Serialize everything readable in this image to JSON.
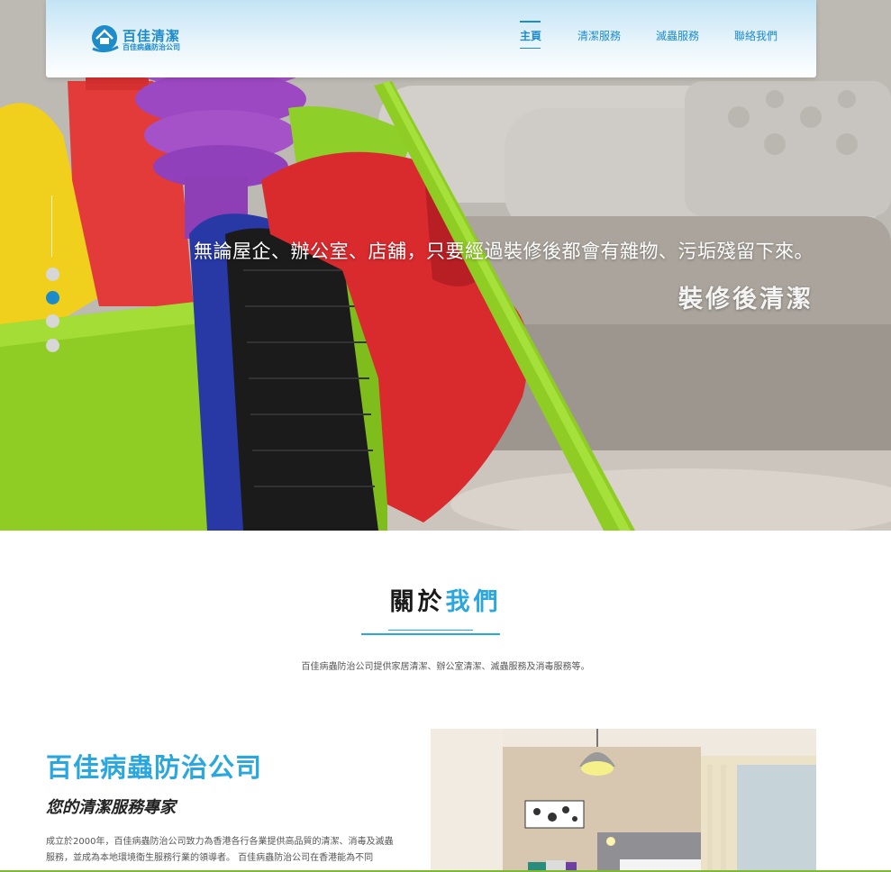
{
  "nav": {
    "logo_title": "百佳清潔",
    "logo_subtitle": "百佳病蟲防治公司",
    "items": [
      {
        "label": "主頁",
        "active": true
      },
      {
        "label": "清潔服務",
        "active": false
      },
      {
        "label": "滅蟲服務",
        "active": false
      },
      {
        "label": "聯絡我們",
        "active": false
      }
    ]
  },
  "hero": {
    "line1": "無論屋企、辦公室、店舖，只要經過裝修後都會有雜物、污垢殘留下來。",
    "line2": "裝修後清潔",
    "slides": 4,
    "active_slide": 2
  },
  "about": {
    "title_dark": "關於",
    "title_blue": "我們",
    "description": "百佳病蟲防治公司提供家居清潔、辦公室清潔、滅蟲服務及消毒服務等。"
  },
  "company": {
    "name": "百佳病蟲防治公司",
    "tagline": "您的清潔服務專家",
    "body": "成立於2000年，百佳病蟲防治公司致力為香港各行各業提供高品質的清潔、消毒及滅蟲服務，並成為本地環境衛生服務行業的領導者。 百佳病蟲防治公司在香港能為不同"
  },
  "colors": {
    "accent": "#2aa7de",
    "nav_blue": "#1e8bcb",
    "slider_active": "#1b8cc9",
    "slider_inactive": "#d7d7d7",
    "bottom_bar": "#7fb834"
  }
}
